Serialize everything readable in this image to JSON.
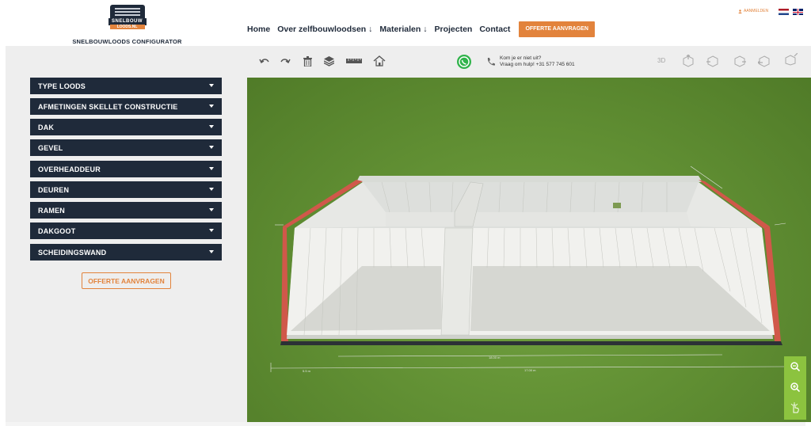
{
  "logo": {
    "badge_line1": "SNELBOUW",
    "badge_line2": "LOODS.NL",
    "text": "SNELBOUWLOODS CONFIGURATOR"
  },
  "nav": {
    "items": [
      {
        "label": "Home"
      },
      {
        "label": "Over zelfbouwloodsen ↓"
      },
      {
        "label": "Materialen ↓"
      },
      {
        "label": "Projecten"
      },
      {
        "label": "Contact"
      }
    ],
    "cta_label": "OFFERTE AANVRAGEN"
  },
  "topbar": {
    "login_label": "AANMELDEN",
    "languages": [
      "nl",
      "en"
    ]
  },
  "sidebar": {
    "sections": [
      {
        "label": "TYPE LOODS"
      },
      {
        "label": "AFMETINGEN SKELLET CONSTRUCTIE"
      },
      {
        "label": "DAK"
      },
      {
        "label": "GEVEL"
      },
      {
        "label": "OVERHEADDEUR"
      },
      {
        "label": "DEUREN"
      },
      {
        "label": "RAMEN"
      },
      {
        "label": "DAKGOOT"
      },
      {
        "label": "SCHEIDINGSWAND"
      }
    ],
    "cta_label": "OFFERTE AANVRAGEN"
  },
  "toolbar": {
    "tools": [
      "undo-icon",
      "redo-icon",
      "trash-icon",
      "layers-icon",
      "ruler-icon",
      "house-icon"
    ],
    "help_line1": "Kom je er niet uit?",
    "help_line2": "Vraag om hulp! +31 577 745 601",
    "view_label": "3D",
    "view_icons": [
      "view-top-icon",
      "view-front-icon",
      "view-right-icon",
      "view-back-icon",
      "view-left-icon"
    ]
  },
  "viewport": {
    "dimension_labels": [
      "5.5 m",
      "17.00 m",
      "18.00 m"
    ],
    "zoom_controls": [
      "zoom-out-icon",
      "zoom-in-icon",
      "pointer-icon"
    ]
  },
  "colors": {
    "navy": "#1f2a3a",
    "accent": "#e2833c",
    "grass": "#5f8d32",
    "zoom_green": "#8cc33f",
    "gutter_red": "#d0584a"
  }
}
